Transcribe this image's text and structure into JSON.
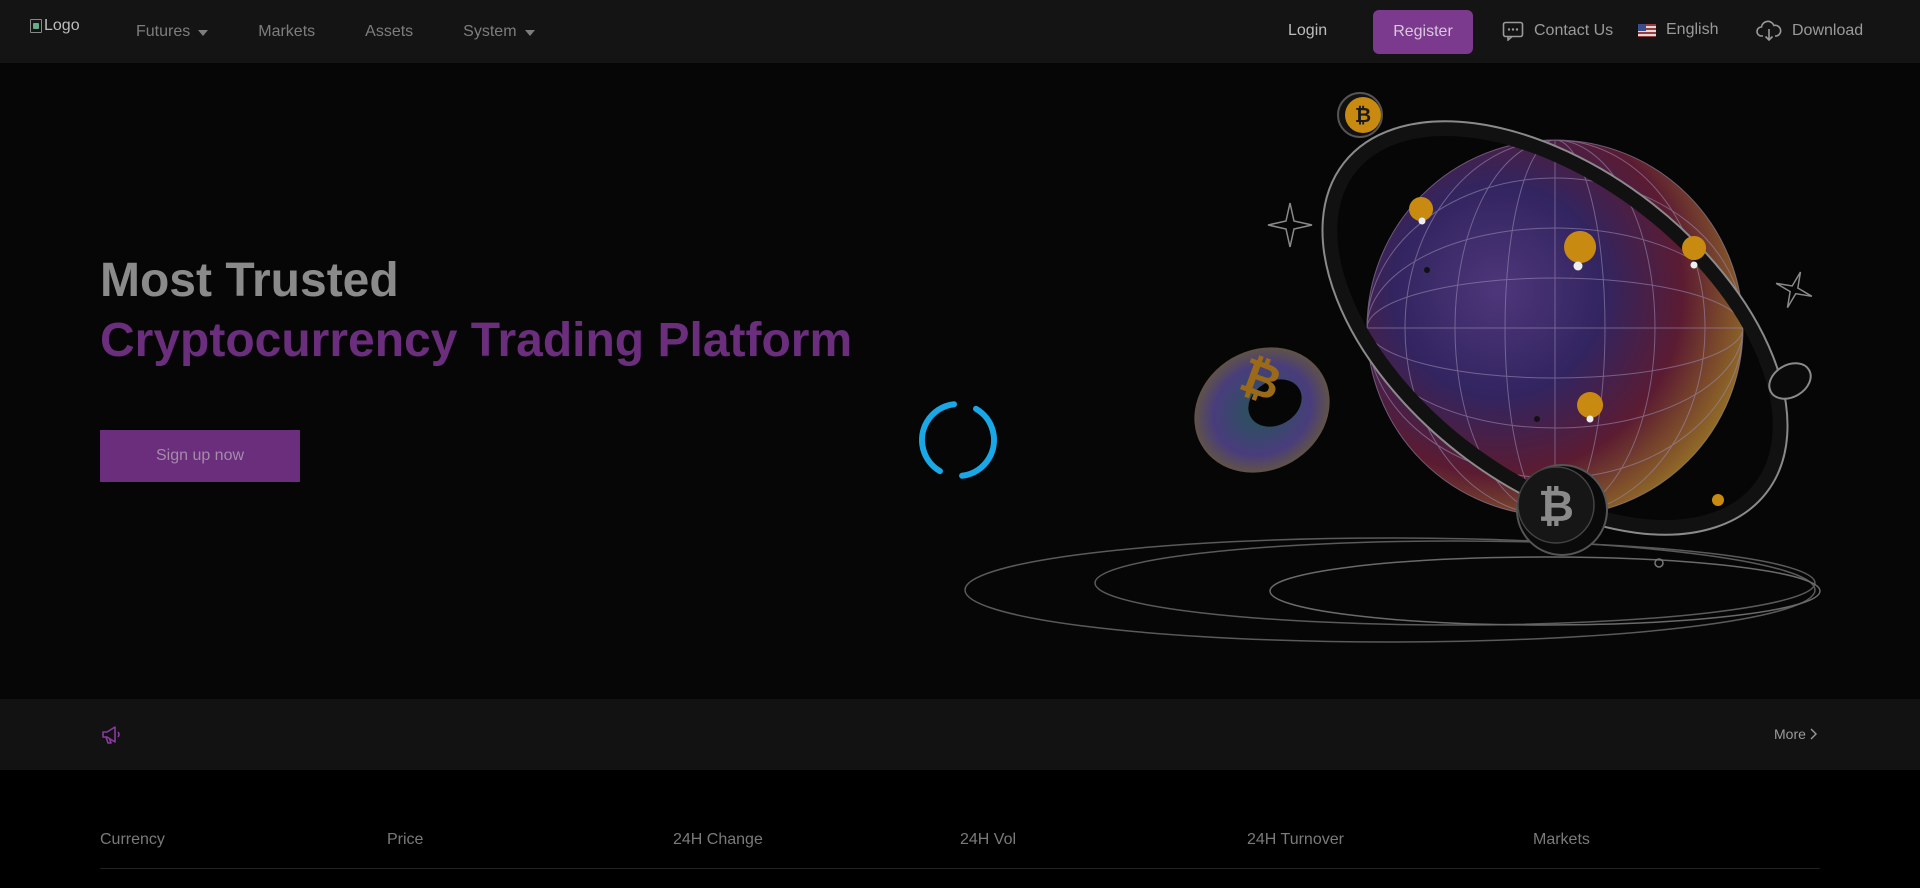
{
  "header": {
    "logo_alt": "Logo",
    "nav": [
      {
        "label": "Futures",
        "has_dropdown": true
      },
      {
        "label": "Markets",
        "has_dropdown": false
      },
      {
        "label": "Assets",
        "has_dropdown": false
      },
      {
        "label": "System",
        "has_dropdown": true
      }
    ],
    "login_label": "Login",
    "register_label": "Register",
    "contact_label": "Contact Us",
    "language_label": "English",
    "download_label": "Download"
  },
  "hero": {
    "title_line1": "Most Trusted",
    "title_line2": "Cryptocurrency Trading Platform",
    "cta_label": "Sign up now"
  },
  "notice": {
    "more_label": "More"
  },
  "table": {
    "columns": [
      "Currency",
      "Price",
      "24H Change",
      "24H Vol",
      "24H Turnover",
      "Markets"
    ]
  },
  "colors": {
    "accent": "#7b3a8e",
    "spinner": "#1aa7e6",
    "coin": "#c98a12"
  }
}
